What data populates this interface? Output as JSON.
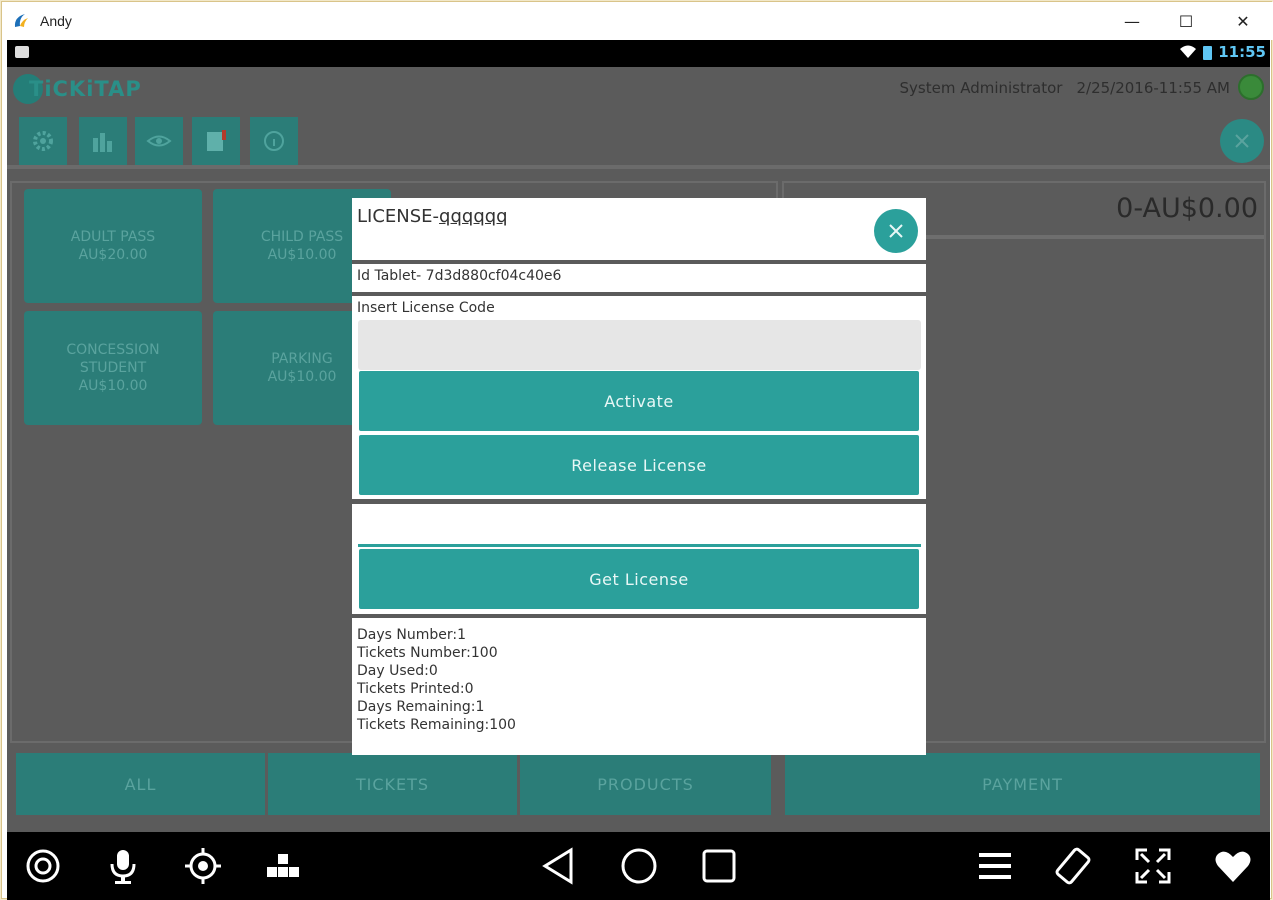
{
  "window": {
    "title": "Andy",
    "minimize": "—",
    "maximize": "☐",
    "close": "✕"
  },
  "statusbar": {
    "time": "11:55"
  },
  "app": {
    "brand": "TiCKiTAP",
    "user": "System Administrator",
    "datetime": "2/25/2016-11:55 AM"
  },
  "toolbar": {
    "items": [
      {
        "icon": "gear-icon"
      },
      {
        "icon": "bar-chart-icon"
      },
      {
        "icon": "eye-icon"
      },
      {
        "icon": "flag-icon"
      },
      {
        "icon": "info-icon"
      }
    ]
  },
  "products": [
    {
      "name": "ADULT PASS",
      "price": "AU$20.00"
    },
    {
      "name": "CHILD PASS",
      "price": "AU$10.00"
    },
    {
      "name": "CONCESSION STUDENT",
      "price": "AU$10.00"
    },
    {
      "name": "PARKING",
      "price": "AU$10.00"
    }
  ],
  "cart": {
    "total": "0-AU$0.00"
  },
  "tabs": [
    "ALL",
    "TICKETS",
    "PRODUCTS"
  ],
  "payment_label": "PAYMENT",
  "dialog": {
    "title_prefix": "LICENSE-",
    "title_code": "qqqqqq",
    "tablet_id": "Id Tablet- 7d3d880cf04c40e6",
    "insert_label": "Insert License Code",
    "license_input_value": "",
    "activate_label": "Activate",
    "release_label": "Release License",
    "get_license_input_value": "",
    "get_label": "Get License",
    "stats": [
      "Days Number:1",
      "Tickets Number:100",
      "Day Used:0",
      "Tickets Printed:0",
      "Days Remaining:1",
      "Tickets Remaining:100"
    ]
  },
  "colors": {
    "teal": "#2ba09b",
    "teal_dark": "#2b7d78",
    "bg": "#5b5b5b",
    "status_blue": "#5fc6f4"
  }
}
